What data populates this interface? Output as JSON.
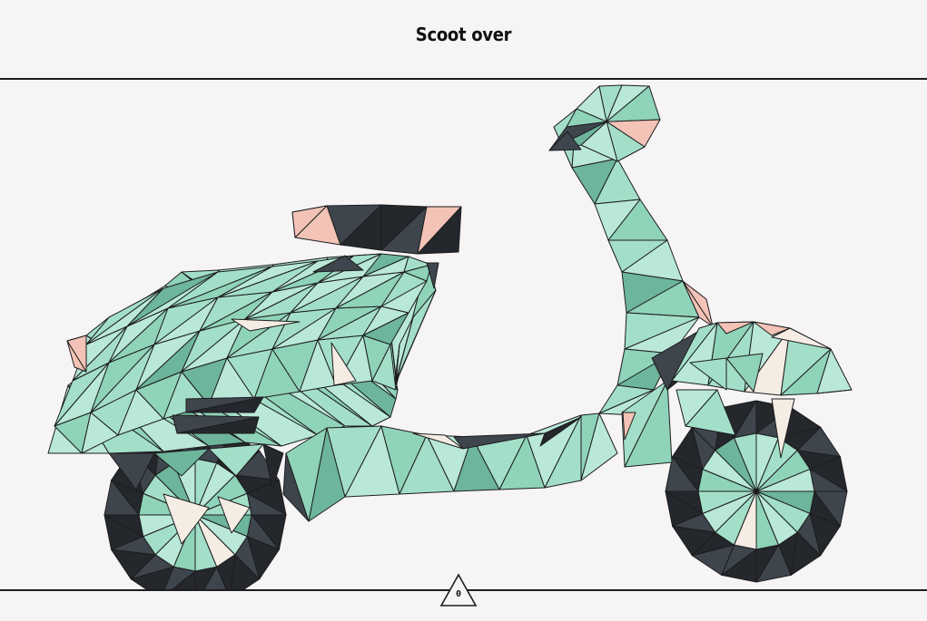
{
  "header": {
    "title": "Scoot over"
  },
  "puzzle": {
    "subject": "scooter",
    "palette": {
      "mint_light": "#b9e8d8",
      "mint": "#a3dfc8",
      "mint_mid": "#8fd3b9",
      "mint_dark": "#6db59b",
      "charcoal": "#3e454d",
      "black": "#24272b",
      "peach": "#f2c3b6",
      "cream": "#f5ece4",
      "outline": "#1d1d1f"
    }
  },
  "footer": {
    "counter_value": "0"
  }
}
